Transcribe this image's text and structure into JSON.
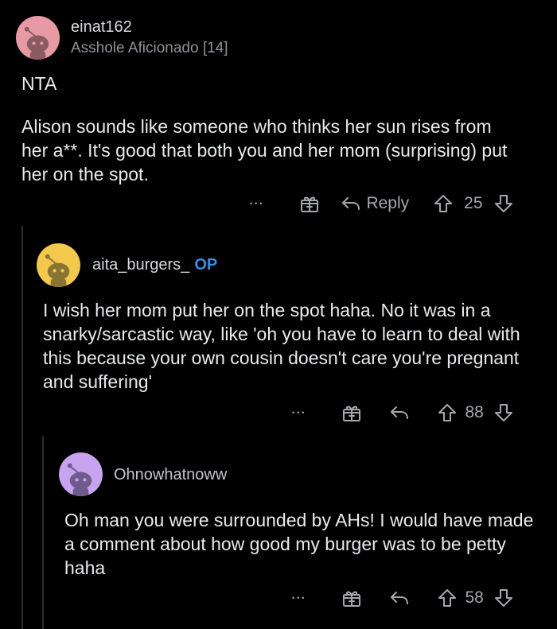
{
  "comments": [
    {
      "username": "einat162",
      "flair": "Asshole Aficionado [14]",
      "avatar_color": "#e89aa4",
      "paragraphs": [
        "NTA",
        "Alison sounds like someone who thinks her sun rises from her a**. It's good that both you and her mom (surprising) put her on the spot."
      ],
      "more": "•••",
      "reply_label": "Reply",
      "score": "25"
    },
    {
      "username": "aita_burgers_",
      "op_badge": "OP",
      "avatar_color": "#f2c94c",
      "paragraphs": [
        "I wish her mom put her on the spot haha. No it was in a snarky/sarcastic way, like 'oh you have to learn to deal with this because your own cousin doesn't care you're pregnant and suffering'"
      ],
      "more": "•••",
      "score": "88"
    },
    {
      "username": "Ohnowhatnoww",
      "avatar_color": "#c8a3f0",
      "paragraphs": [
        "Oh man you were surrounded by AHs! I would have made a comment about how good my burger was to be petty haha"
      ],
      "more": "•••",
      "score": "58"
    }
  ],
  "colors": {
    "background": "#000000",
    "text": "#e8eaec",
    "muted": "#a5a8ab",
    "op": "#3a8de0",
    "thread_line": "#2b2d2f"
  },
  "icons": [
    "snoo-avatar-icon",
    "gift-award-icon",
    "reply-arrow-icon",
    "upvote-arrow-icon",
    "downvote-arrow-icon",
    "more-options-icon"
  ]
}
